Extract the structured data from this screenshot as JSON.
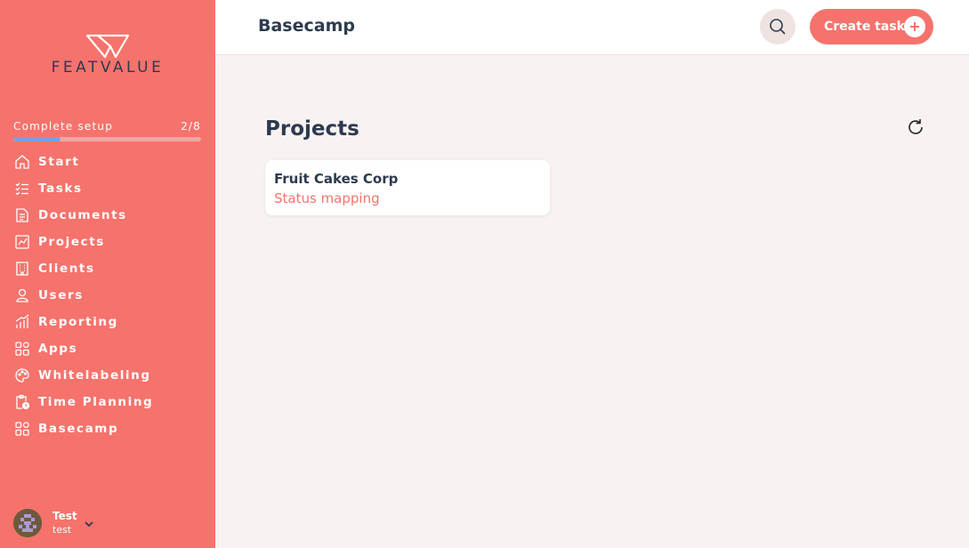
{
  "brand": {
    "name": "FEATVALUE"
  },
  "setup": {
    "label": "Complete setup",
    "progress_text": "2/8",
    "progress": 0.25
  },
  "nav": [
    {
      "label": "Start",
      "icon": "home-icon"
    },
    {
      "label": "Tasks",
      "icon": "checklist-icon"
    },
    {
      "label": "Documents",
      "icon": "documents-icon"
    },
    {
      "label": "Projects",
      "icon": "projects-icon"
    },
    {
      "label": "Clients",
      "icon": "building-icon"
    },
    {
      "label": "Users",
      "icon": "user-icon"
    },
    {
      "label": "Reporting",
      "icon": "chart-icon"
    },
    {
      "label": "Apps",
      "icon": "apps-icon"
    },
    {
      "label": "Whitelabeling",
      "icon": "palette-icon"
    },
    {
      "label": "Time Planning",
      "icon": "clipboard-clock-icon"
    },
    {
      "label": "Basecamp",
      "icon": "apps-icon"
    }
  ],
  "user": {
    "name": "Test",
    "handle": "test"
  },
  "header": {
    "title": "Basecamp",
    "create_label": "Create task"
  },
  "main": {
    "section_title": "Projects",
    "projects": [
      {
        "name": "Fruit Cakes Corp",
        "status": "Status mapping"
      }
    ]
  },
  "colors": {
    "accent": "#f5736c",
    "text": "#2d3a4f",
    "progress": "#7aa0e4",
    "background": "#f8f3f2"
  }
}
